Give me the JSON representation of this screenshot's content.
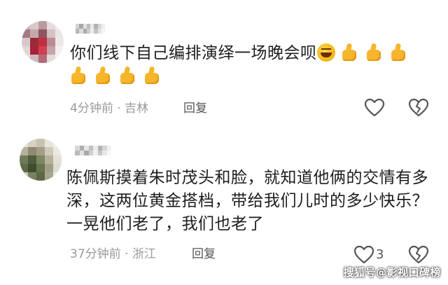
{
  "comments": [
    {
      "text": "你们线下自己编排演绎一场晚会呗",
      "time": "4分钟前",
      "separator": "·",
      "location": "吉林",
      "reply_label": "回复",
      "emojis": [
        "laughing-crying",
        "thumbs-up",
        "thumbs-up",
        "thumbs-up",
        "thumbs-up",
        "thumbs-up",
        "thumbs-up",
        "thumbs-up"
      ]
    },
    {
      "text": "陈佩斯摸着朱时茂头和脸，就知道他俩的交情有多深，这两位黄金搭档，带给我们儿时的多少快乐？一晃他们老了，我们也老了",
      "time": "37分钟前",
      "separator": "·",
      "location": "浙江",
      "reply_label": "回复",
      "like_count": "3"
    }
  ],
  "watermark": "搜狐号@影视口碑榜",
  "colors": {
    "meta_text": "#9a9a9a",
    "icon_stroke": "#555555",
    "thumb": "#f7b52c"
  }
}
